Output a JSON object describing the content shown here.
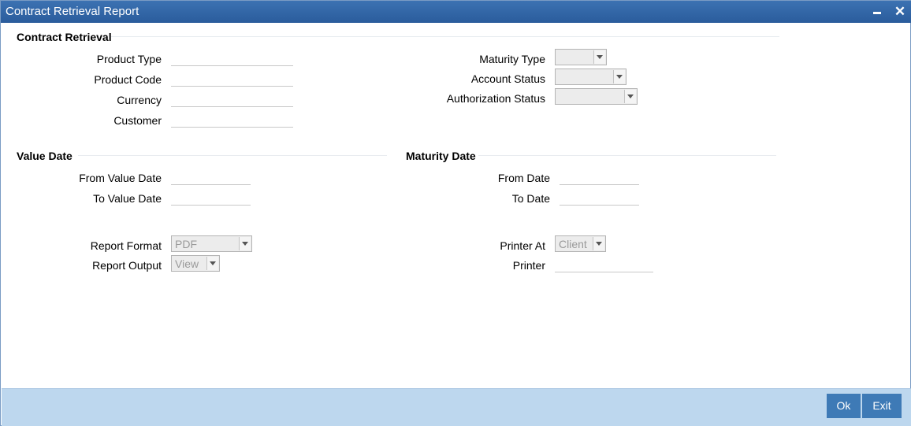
{
  "window": {
    "title": "Contract Retrieval Report",
    "minimize_icon": "minimize-icon",
    "close_icon": "close-icon",
    "close_glyph": "✕"
  },
  "contract_retrieval": {
    "title": "Contract Retrieval",
    "product_type_label": "Product Type",
    "product_code_label": "Product Code",
    "currency_label": "Currency",
    "customer_label": "Customer",
    "maturity_type_label": "Maturity Type",
    "maturity_type_value": "",
    "account_status_label": "Account Status",
    "account_status_value": "",
    "authorization_status_label": "Authorization Status",
    "authorization_status_value": ""
  },
  "value_date": {
    "title": "Value Date",
    "from_label": "From Value Date",
    "to_label": "To Value Date"
  },
  "maturity_date": {
    "title": "Maturity Date",
    "from_label": "From Date",
    "to_label": "To Date"
  },
  "report": {
    "format_label": "Report Format",
    "format_value": "PDF",
    "output_label": "Report Output",
    "output_value": "View",
    "printer_at_label": "Printer At",
    "printer_at_value": "Client",
    "printer_label": "Printer"
  },
  "footer": {
    "ok_label": "Ok",
    "exit_label": "Exit"
  },
  "colors": {
    "titlebar": "#2f66a8",
    "footer": "#bdd7ee",
    "button": "#3e7ab6"
  }
}
